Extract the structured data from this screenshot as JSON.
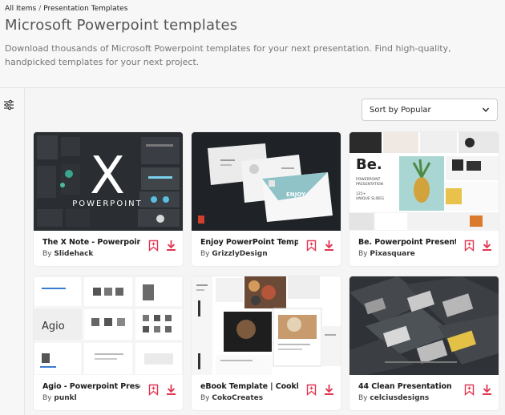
{
  "breadcrumb": {
    "root": "All Items",
    "separator": "/",
    "current": "Presentation Templates"
  },
  "page": {
    "title": "Microsoft Powerpoint templates",
    "description": "Download thousands of Microsoft Powerpoint templates for your next presentation. Find high-quality, handpicked templates for your next project."
  },
  "sort": {
    "label": "Sort by Popular"
  },
  "author_prefix": "By",
  "colors": {
    "accent": "#e03553",
    "thumbnail_dark": "#2b2f33"
  },
  "thumb_text": {
    "card1_letter": "X",
    "card1_word": "POWERPOINT",
    "card2_word": "ENJOY",
    "card3_word": "Be.",
    "card3_line1": "POWERPOINT",
    "card3_line2": "PRESENTATION",
    "card3_line3": "125+",
    "card3_line4": "UNIQUE SLIDES",
    "card4_word": "Agio"
  },
  "cards": [
    {
      "title": "The X Note - Powerpoint T...",
      "author": "Slidehack"
    },
    {
      "title": "Enjoy PowerPoint Template",
      "author": "GrizzlyDesign"
    },
    {
      "title": "Be. Powerpoint Presentation...",
      "author": "Pixasquare"
    },
    {
      "title": "Agio - Powerpoint Present...",
      "author": "punkl"
    },
    {
      "title": "eBook Template | Cookbo...",
      "author": "CokoCreates"
    },
    {
      "title": "44 Clean Presentation",
      "author": "celciusdesigns"
    }
  ],
  "icons": {
    "bookmark": "bookmark-icon",
    "download": "download-icon",
    "filter": "filter-sliders-icon",
    "sort": "chevron-down-icon"
  }
}
